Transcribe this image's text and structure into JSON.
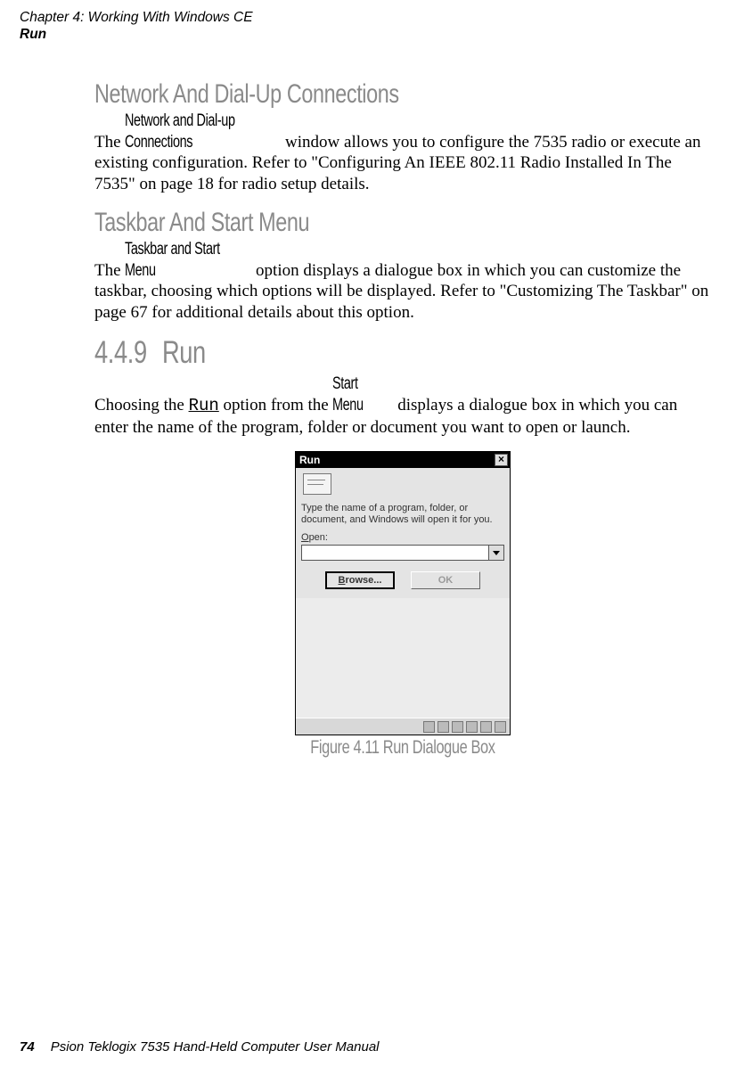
{
  "header": {
    "chapter": "Chapter 4:  Working With Windows CE",
    "section": "Run"
  },
  "net": {
    "heading": "Network And Dial-Up Connections",
    "inline_term": "Network and Dial-up Connections",
    "para_pre": "The ",
    "para_post": " window allows you to configure the 7535 radio or execute an existing configuration. Refer to \"Configuring An IEEE 802.11 Radio Installed In The 7535\" on page 18 for radio setup details."
  },
  "taskbar": {
    "heading": "Taskbar And Start Menu",
    "inline_term": " Taskbar and Start Menu ",
    "para_pre": "The ",
    "para_post": " option displays a dialogue box in which you can customize the taskbar, choosing which options will be displayed. Refer to \"Customizing The Taskbar\" on page 67 for additional details about this option."
  },
  "s449": {
    "number": "4.4.9",
    "title": "Run",
    "para_pre": "Choosing the ",
    "mono": "Run",
    "para_mid1": " option from the ",
    "inline_term": "Start Menu",
    "para_post": " displays a dialogue box in which you can enter the name of the program, folder or document you want to open or launch."
  },
  "dialog": {
    "title": "Run",
    "close_glyph": "×",
    "blurb": "Type the name of a program, folder, or document, and Windows will open it for you.",
    "open_label_ul": "O",
    "open_label_rest": "pen:",
    "input_value": "",
    "browse_ul": "B",
    "browse_rest": "rowse...",
    "ok_label": "OK"
  },
  "figure": {
    "caption": "Figure 4.11 Run Dialogue Box"
  },
  "footer": {
    "page": "74",
    "book": "Psion Teklogix 7535 Hand-Held Computer User Manual"
  }
}
